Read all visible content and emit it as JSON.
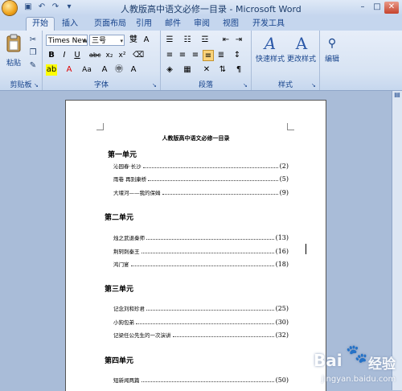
{
  "window": {
    "title": "人教版高中语文必修一目录 - Microsoft Word",
    "controls": [
      "–",
      "□",
      "✕"
    ]
  },
  "qat": [
    "save-icon",
    "undo-icon",
    "redo-icon",
    "customize-icon"
  ],
  "tabs": [
    "开始",
    "插入",
    "页面布局",
    "引用",
    "邮件",
    "审阅",
    "视图",
    "开发工具"
  ],
  "ribbon": {
    "clipboard": {
      "paste": "粘贴",
      "label": "剪贴板"
    },
    "font": {
      "name": "Times New F",
      "size": "三号",
      "label": "字体"
    },
    "paragraph": {
      "label": "段落"
    },
    "styles": {
      "quick": "快速样式",
      "change": "更改样式",
      "label": "样式"
    },
    "editing": {
      "edit": "编辑"
    }
  },
  "document": {
    "title": "人教版高中语文必修一目录",
    "units": [
      {
        "name": "第一单元",
        "items": [
          {
            "text": "沁园春·长沙",
            "page": "(2)"
          },
          {
            "text": "雨巷 再别康桥",
            "page": "(5)"
          },
          {
            "text": "大堰河——我的保姆",
            "page": "(9)"
          }
        ]
      },
      {
        "name": "第二单元",
        "items": [
          {
            "text": "烛之武退秦师",
            "page": "(13)"
          },
          {
            "text": "荆轲刺秦王",
            "page": "(16)"
          },
          {
            "text": "鸿门宴",
            "page": "(18)"
          }
        ]
      },
      {
        "name": "第三单元",
        "items": [
          {
            "text": "记念刘和珍君",
            "page": "(25)"
          },
          {
            "text": "小狗包弟",
            "page": "(30)"
          },
          {
            "text": "记梁任公先生的一次演讲",
            "page": "(32)"
          }
        ]
      },
      {
        "name": "第四单元",
        "items": [
          {
            "text": "短新闻两篇",
            "page": "(50)"
          }
        ]
      }
    ]
  },
  "watermark": {
    "logo": "Bai",
    "cn": "经验",
    "url": "jingyan.baidu.com"
  },
  "colors": {
    "ribbon": "#d7e3f3",
    "workspace": "#a9bcd8",
    "accent": "#15428b"
  }
}
